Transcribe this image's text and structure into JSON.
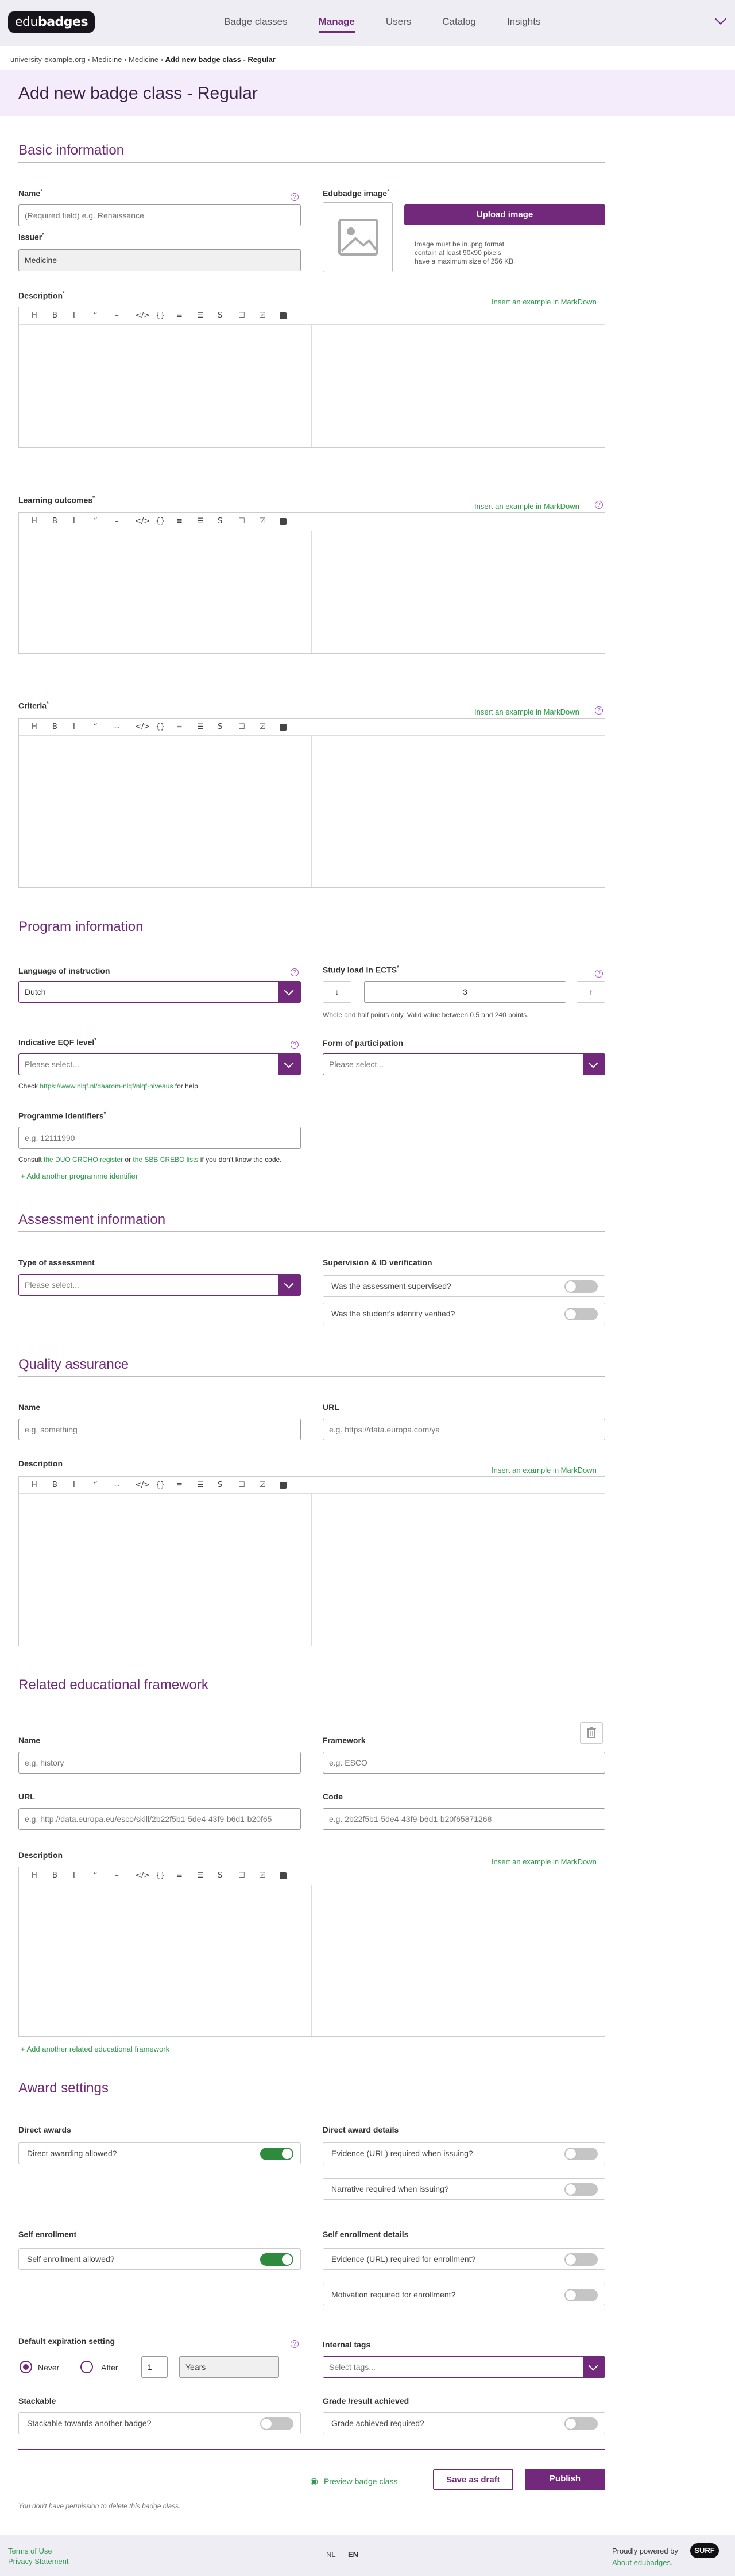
{
  "nav": {
    "logo_text_a": "edu",
    "logo_text_b": "badges",
    "items": [
      "Badge classes",
      "Manage",
      "Users",
      "Catalog",
      "Insights"
    ]
  },
  "breadcrumb": {
    "items": [
      "university-example.org",
      "Medicine",
      "Medicine"
    ],
    "current": "Add new badge class - Regular",
    "separator": "›"
  },
  "page": {
    "title": "Add new badge class - Regular"
  },
  "basic": {
    "heading": "Basic information",
    "name_label": "Name",
    "name_placeholder": "(Required field) e.g. Renaissance",
    "issuer_label": "Issuer",
    "issuer_value": "Medicine",
    "image_label": "Edubadge image",
    "upload_label": "Upload image",
    "image_rules": [
      "Image must be in .png format",
      "contain at least 90x90 pixels",
      "have a maximum size of 256 KB"
    ],
    "description_label": "Description",
    "lo_label": "Learning outcomes",
    "criteria_label": "Criteria",
    "insert_example": "Insert an example in MarkDown",
    "required_mark": "*",
    "help_mark": "?"
  },
  "toolbar": [
    "H",
    "B",
    "I",
    "“",
    "⌢",
    "</>",
    "{}",
    "≡",
    "☰",
    "S",
    "☐",
    "☑"
  ],
  "program": {
    "heading": "Program information",
    "language_label": "Language of instruction",
    "language_value": "Dutch",
    "ects_label": "Study load in ECTS",
    "ects_value": "3",
    "ects_hint": "Whole and half points only. Valid value between 0.5 and 240 points.",
    "eqf_label": "Indicative EQF level",
    "eqf_placeholder": "Please select...",
    "eqf_help_pre": "Check ",
    "eqf_help_link": "https://www.nlqf.nl/daarom-nlqf/nlqf-niveaus",
    "eqf_help_post": " for help",
    "participation_label": "Form of participation",
    "participation_placeholder": "Please select...",
    "identifiers_label": "Programme Identifiers",
    "identifiers_placeholder": "e.g. 12111990",
    "consult_pre": "Consult ",
    "consult_link1": "the DUO CROHO register",
    "consult_mid": " or ",
    "consult_link2": "the SBB CREBO lists",
    "consult_post": " if you don't know the code.",
    "add_identifier": "+ Add another programme identifier"
  },
  "assessment": {
    "heading": "Assessment information",
    "type_label": "Type of assessment",
    "type_placeholder": "Please select...",
    "supervision_label": "Supervision & ID verification",
    "supervised_q": "Was the assessment supervised?",
    "identity_q": "Was the student's identity verified?"
  },
  "quality": {
    "heading": "Quality assurance",
    "name_label": "Name",
    "name_placeholder": "e.g. something",
    "url_label": "URL",
    "url_placeholder": "e.g. https://data.europa.com/ya",
    "description_label": "Description"
  },
  "framework": {
    "heading": "Related educational framework",
    "name_label": "Name",
    "name_placeholder": "e.g. history",
    "framework_label": "Framework",
    "framework_placeholder": "e.g. ESCO",
    "url_label": "URL",
    "url_placeholder": "e.g. http://data.europa.eu/esco/skill/2b22f5b1-5de4-43f9-b6d1-b20f65",
    "code_label": "Code",
    "code_placeholder": "e.g. 2b22f5b1-5de4-43f9-b6d1-b20f65871268",
    "description_label": "Description",
    "add_framework": "+ Add another related educational framework"
  },
  "award": {
    "heading": "Award settings",
    "direct_label": "Direct awards",
    "direct_q": "Direct awarding allowed?",
    "direct_details_label": "Direct award details",
    "evidence_issuing_q": "Evidence (URL) required when issuing?",
    "narrative_issuing_q": "Narrative required when issuing?",
    "self_label": "Self enrollment",
    "self_q": "Self enrollment allowed?",
    "self_details_label": "Self enrollment details",
    "evidence_enroll_q": "Evidence (URL) required for enrollment?",
    "motivation_q": "Motivation required for enrollment?",
    "expiration_label": "Default expiration setting",
    "never_label": "Never",
    "after_label": "After",
    "after_value": "1",
    "period_value": "Years",
    "tags_label": "Internal tags",
    "tags_placeholder": "Select tags...",
    "stackable_label": "Stackable",
    "stackable_q": "Stackable towards another badge?",
    "grade_label": "Grade /result achieved",
    "grade_q": "Grade achieved required?"
  },
  "toggles": {
    "supervised": false,
    "identity": false,
    "direct": true,
    "evidence_issuing": false,
    "narrative_issuing": false,
    "self": true,
    "evidence_enroll": false,
    "motivation": false,
    "stackable": false,
    "grade": false
  },
  "actions": {
    "preview": "Preview badge class",
    "save_draft": "Save as draft",
    "publish": "Publish",
    "no_permission": "You don't have permission to delete this badge class."
  },
  "footer": {
    "terms": "Terms of Use",
    "privacy": "Privacy Statement",
    "lang_nl": "NL",
    "lang_en": "EN",
    "powered": "Proudly powered by",
    "surf": "SURF",
    "about": "About edubadges."
  },
  "colors": {
    "accent": "#72297b",
    "link": "#2e9a4e",
    "toggle_on": "#2e8b3e"
  }
}
